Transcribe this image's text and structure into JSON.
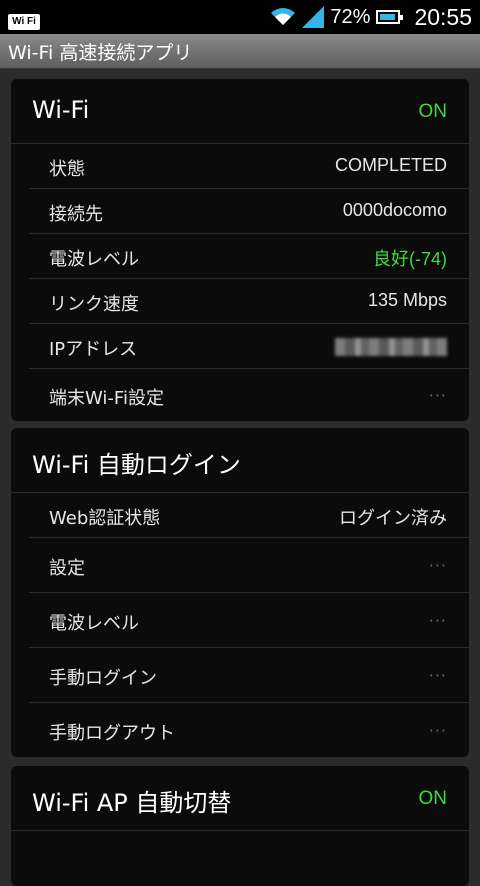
{
  "status_bar": {
    "badge": "Wi Fi",
    "battery": "72%",
    "time": "20:55"
  },
  "app_title": "Wi-Fi 高速接続アプリ",
  "wifi_card": {
    "title": "Wi-Fi",
    "state": "ON",
    "rows": [
      {
        "label": "状態",
        "value": "COMPLETED"
      },
      {
        "label": "接続先",
        "value": "0000docomo"
      },
      {
        "label": "電波レベル",
        "value": "良好(-74)"
      },
      {
        "label": "リンク速度",
        "value": "135 Mbps"
      },
      {
        "label": "IPアドレス",
        "value": ""
      },
      {
        "label": "端末Wi-Fi設定",
        "value": "···"
      }
    ]
  },
  "auto_login_card": {
    "title": "Wi-Fi 自動ログイン",
    "rows": [
      {
        "label": "Web認証状態",
        "value": "ログイン済み"
      },
      {
        "label": "設定",
        "value": "···"
      },
      {
        "label": "電波レベル",
        "value": "···"
      },
      {
        "label": "手動ログイン",
        "value": "···"
      },
      {
        "label": "手動ログアウト",
        "value": "···"
      }
    ]
  },
  "ap_card": {
    "title": "Wi-Fi AP 自動切替",
    "state": "ON"
  }
}
